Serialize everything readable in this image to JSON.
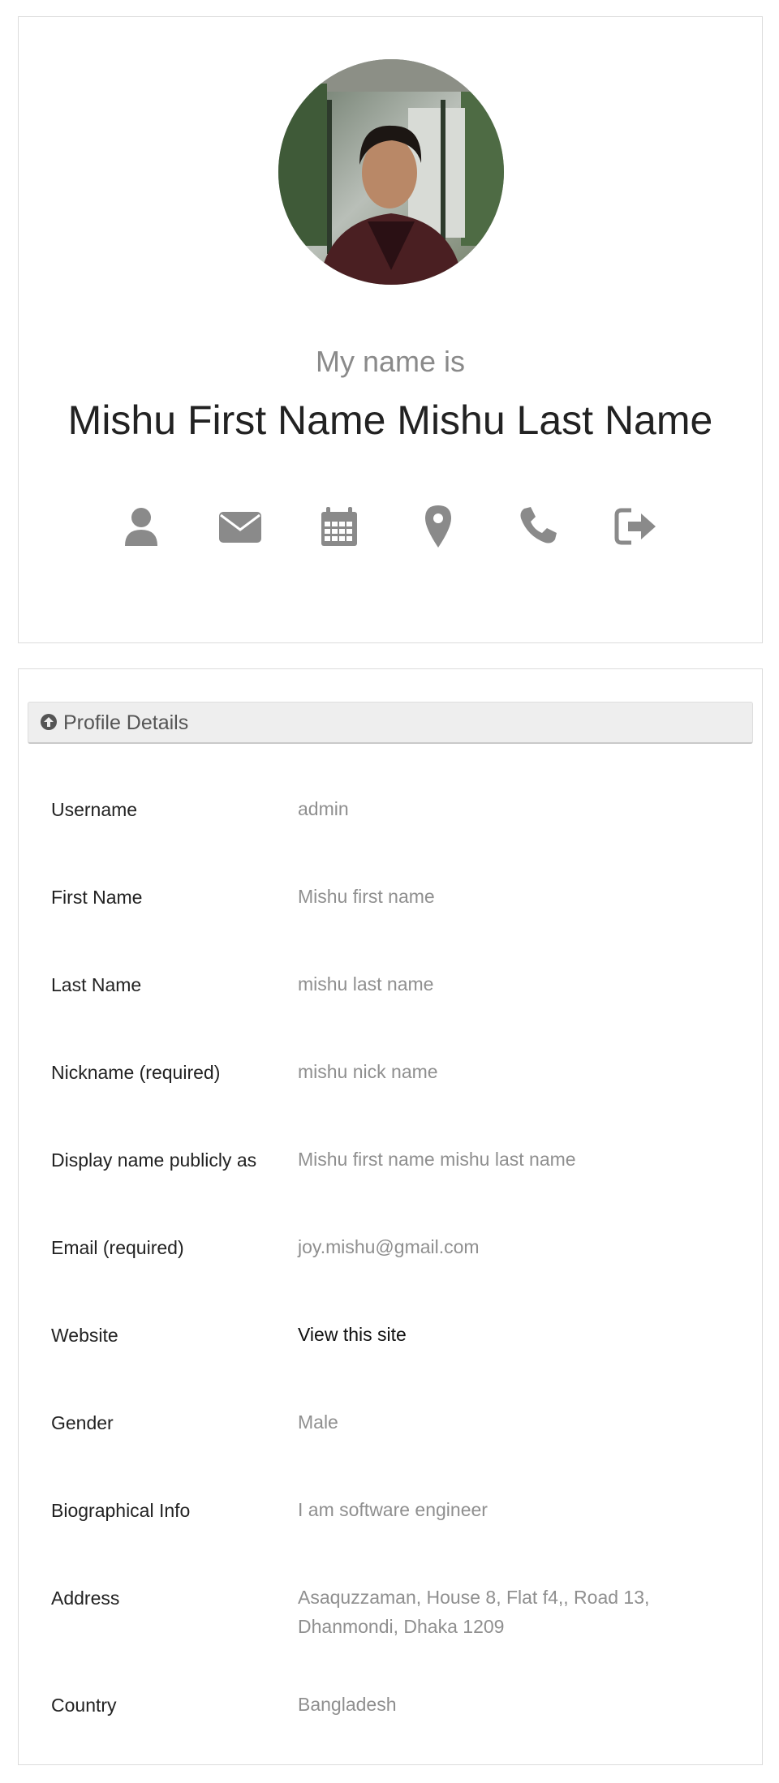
{
  "profile": {
    "intro": "My name is",
    "full_name": "Mishu First Name Mishu Last Name",
    "avatar_alt": "profile photo",
    "icons": [
      "user-icon",
      "envelope-icon",
      "calendar-icon",
      "map-marker-icon",
      "phone-icon",
      "sign-out-icon"
    ],
    "icon_color": "#8a8a8a"
  },
  "details": {
    "section_title": "Profile Details",
    "section_icon": "arrow-circle-up-icon",
    "rows": [
      {
        "label": "Username",
        "value": "admin"
      },
      {
        "label": "First Name",
        "value": "Mishu first name"
      },
      {
        "label": "Last Name",
        "value": "mishu last name"
      },
      {
        "label": "Nickname (required)",
        "value": "mishu nick name"
      },
      {
        "label": "Display name publicly as",
        "value": "Mishu first name mishu last name"
      },
      {
        "label": "Email (required)",
        "value": "joy.mishu@gmail.com"
      },
      {
        "label": "Website",
        "value": "View this site"
      },
      {
        "label": "Gender",
        "value": "Male"
      },
      {
        "label": "Biographical Info",
        "value": "I am software engineer"
      },
      {
        "label": "Address",
        "value": "Asaquzzaman, House 8, Flat f4,, Road 13, Dhanmondi, Dhaka 1209"
      },
      {
        "label": "Country",
        "value": "Bangladesh"
      }
    ]
  }
}
